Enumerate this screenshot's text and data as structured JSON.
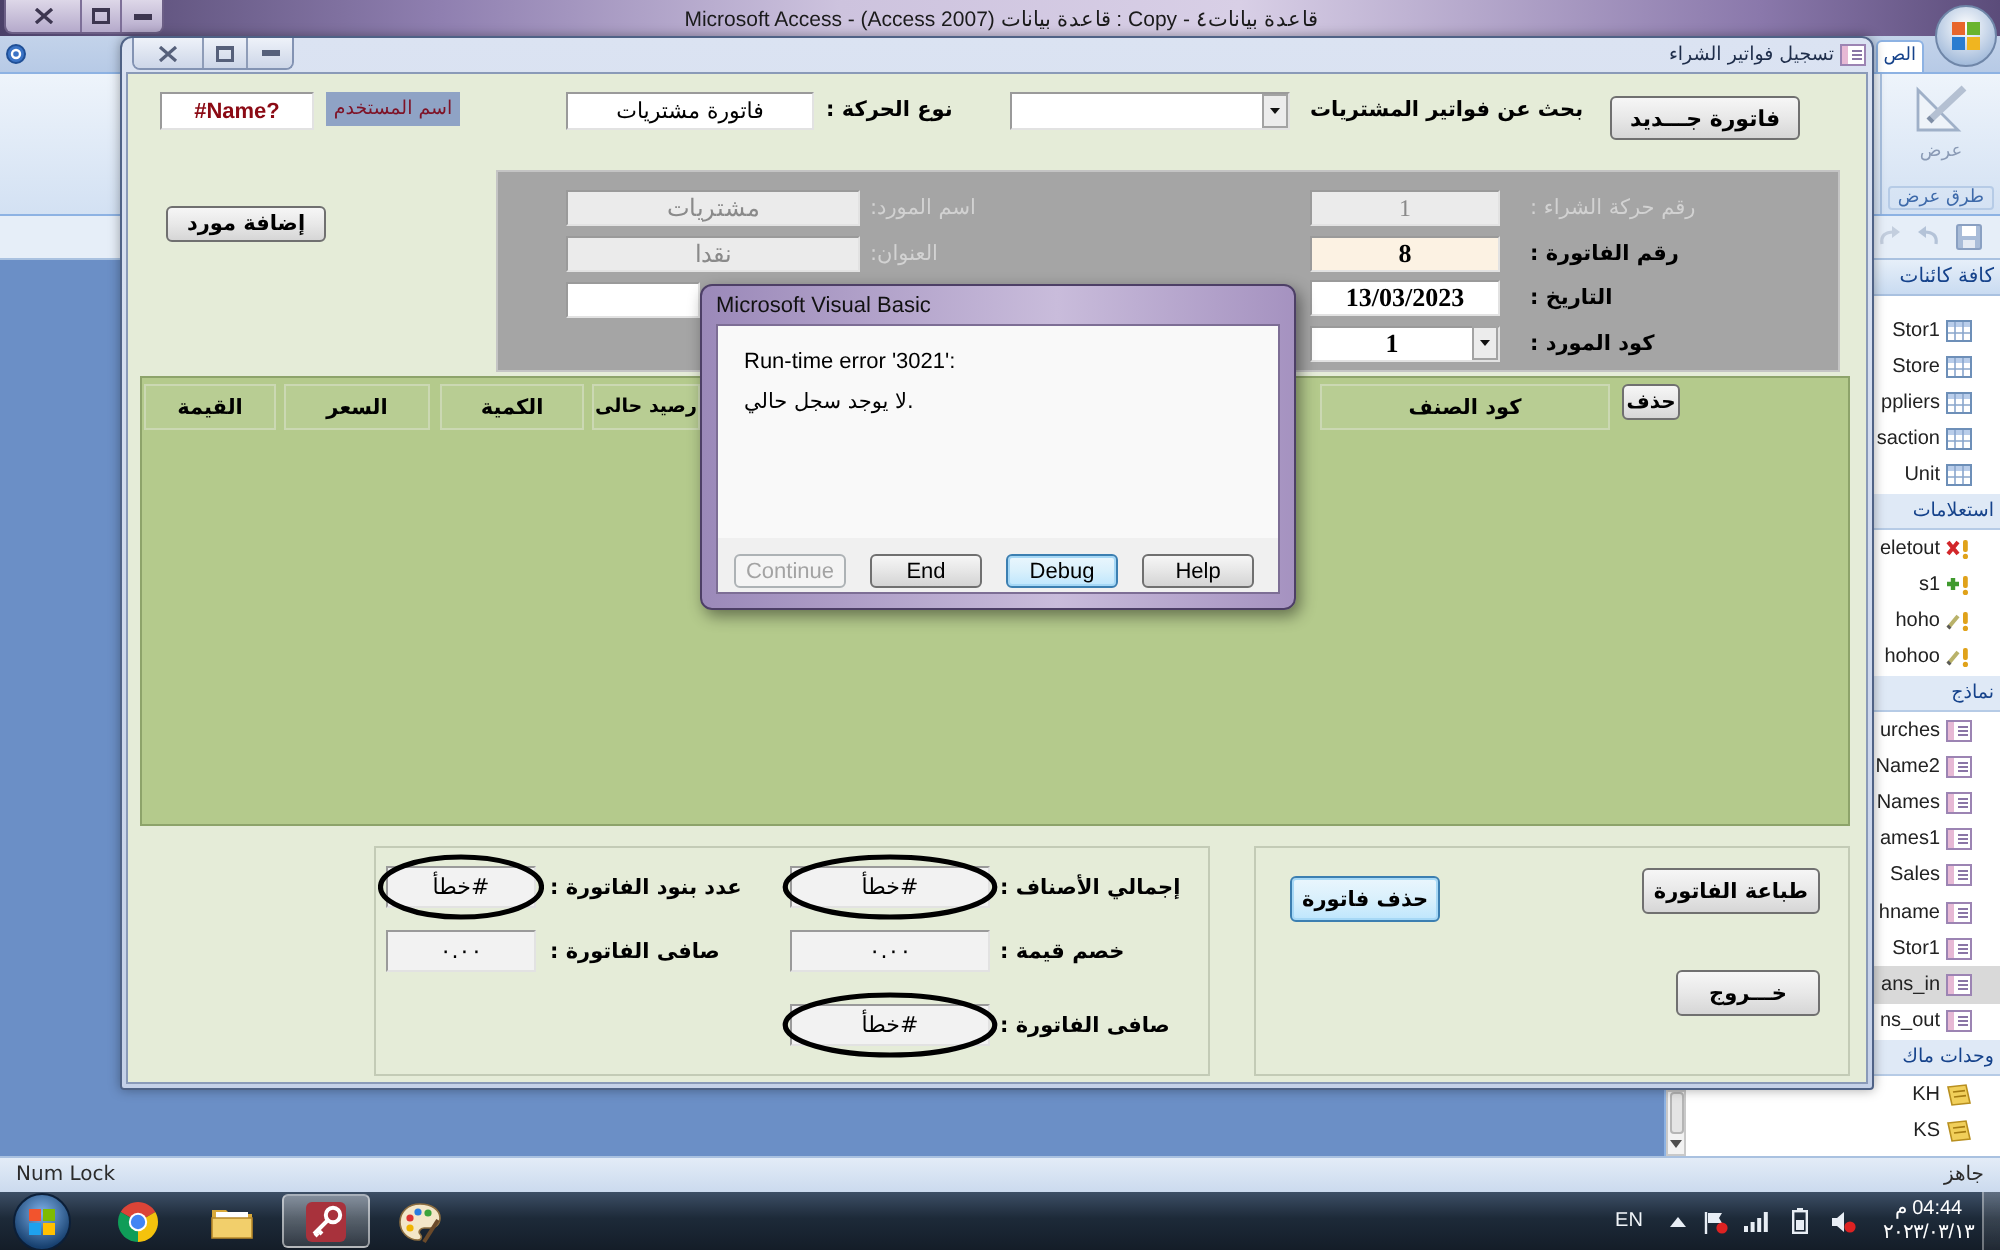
{
  "app_window": {
    "title": "Microsoft Access - (Access 2007) قاعدة بيانات : Copy - قاعدة بيانات٤"
  },
  "ribbon": {
    "tabs": [
      {
        "label": "الص",
        "selected": true
      }
    ],
    "view_button": "عرض",
    "group_label": "طرق عرض"
  },
  "form_window": {
    "title": "تسجيل فواتير الشراء",
    "header": {
      "user_value": "#Name?",
      "user_label": "اسم المستخدم",
      "transaction_type_label": "نوع الحركة :",
      "transaction_type_value": "فاتورة مشتريات",
      "search_label": "بحث عن فواتير المشتريات",
      "new_invoice_button": "فاتورة جـــديد"
    },
    "add_supplier_button": "إضافة مورد",
    "details": {
      "left": [
        {
          "kind": "text",
          "label": "اسم المورد:",
          "value": "مشتريات",
          "disabled": true,
          "highlighted": false
        },
        {
          "kind": "text",
          "label": "العنوان:",
          "value": "نقدا",
          "disabled": true,
          "highlighted": false
        },
        {
          "kind": "text",
          "disabled": false,
          "highlighted": false
        }
      ],
      "right": [
        {
          "kind": "text",
          "label": "رقم حركة الشراء :",
          "value": "1",
          "disabled": true,
          "highlighted": false
        },
        {
          "kind": "text",
          "label": "رقم الفاتورة :",
          "value": "8",
          "disabled": false,
          "highlighted": true
        },
        {
          "kind": "text",
          "label": "التاريخ :",
          "value": "13/03/2023",
          "disabled": false,
          "highlighted": false
        },
        {
          "kind": "combo",
          "label": "كود المورد :",
          "value": "1",
          "disabled": false,
          "highlighted": false
        }
      ]
    },
    "items_grid": {
      "delete_button": "حذف",
      "columns": [
        "كود الصنف",
        "رصيد حالى",
        "الكمية",
        "السعر",
        "القيمة"
      ]
    },
    "summary": {
      "right_column": [
        {
          "label": "إجمالي الأصناف :",
          "value": "#خطأ",
          "circled": true
        },
        {
          "label": "خصم قيمة :",
          "value": "٠.٠٠",
          "circled": false
        },
        {
          "label": "صافى الفاتورة :",
          "value": "#خطأ",
          "circled": true
        }
      ],
      "left_column": [
        {
          "label": "عدد بنود الفاتورة :",
          "value": "#خطأ",
          "circled": true
        },
        {
          "label": "صافى الفاتورة :",
          "value": "٠.٠٠",
          "circled": false
        }
      ]
    },
    "actions": {
      "right_buttons": [
        {
          "label": "طباعة الفاتورة",
          "focused": false
        },
        {
          "label": "خـــروج",
          "focused": false
        }
      ],
      "left_buttons": [
        {
          "label": "حذف فاتورة",
          "focused": true
        }
      ]
    }
  },
  "error_dialog": {
    "title": "Microsoft Visual Basic",
    "error": "Run-time error '3021':",
    "message": "لا يوجد سجل حالي.",
    "buttons": [
      {
        "label": "Help",
        "disabled": false,
        "focused": false
      },
      {
        "label": "Debug",
        "disabled": false,
        "focused": true
      },
      {
        "label": "End",
        "disabled": false,
        "focused": false
      },
      {
        "label": "Continue",
        "disabled": true,
        "focused": false
      }
    ]
  },
  "navigation_pane": {
    "title": "كافة كائنات",
    "groups": [
      {
        "items": [
          {
            "name": "Stor1",
            "kind": "table",
            "selected": false
          },
          {
            "name": "Store",
            "kind": "table",
            "selected": false
          },
          {
            "name": "ppliers",
            "kind": "table",
            "selected": false
          },
          {
            "name": "saction",
            "kind": "table",
            "selected": false
          },
          {
            "name": "Unit",
            "kind": "table",
            "selected": false
          }
        ]
      },
      {
        "label": "استعلامات",
        "items": [
          {
            "name": "eletout",
            "kind": "delete_query",
            "selected": false
          },
          {
            "name": "s1",
            "kind": "append_query",
            "selected": false
          },
          {
            "name": "hoho",
            "kind": "update_query",
            "selected": false
          },
          {
            "name": "hohoo",
            "kind": "update_query",
            "selected": false
          }
        ]
      },
      {
        "label": "نماذج",
        "items": [
          {
            "name": "urches",
            "kind": "form",
            "selected": false
          },
          {
            "name": "Name2",
            "kind": "form",
            "selected": false
          },
          {
            "name": "Names",
            "kind": "form",
            "selected": false
          },
          {
            "name": "ames1",
            "kind": "form",
            "selected": false
          },
          {
            "name": "Sales",
            "kind": "form",
            "selected": false
          },
          {
            "name": "hname",
            "kind": "form",
            "selected": false
          },
          {
            "name": "Stor1",
            "kind": "form",
            "selected": false
          },
          {
            "name": "ans_in",
            "kind": "form",
            "selected": true
          },
          {
            "name": "ns_out",
            "kind": "form",
            "selected": false
          }
        ]
      },
      {
        "label": "وحدات ماك",
        "items": [
          {
            "name": "KH",
            "kind": "module",
            "selected": false
          },
          {
            "name": "KS",
            "kind": "module",
            "selected": false
          }
        ]
      }
    ]
  },
  "status_bar": {
    "left": "Num Lock",
    "right": "جاهز"
  },
  "taskbar": {
    "apps": [
      {
        "kind": "browser",
        "selected": false
      },
      {
        "kind": "files",
        "selected": false
      },
      {
        "kind": "database",
        "selected": true
      },
      {
        "kind": "paint",
        "selected": false
      }
    ],
    "language": "EN",
    "time": "04:44 م",
    "date": "٢٠٢٣/٠٣/١٣"
  }
}
